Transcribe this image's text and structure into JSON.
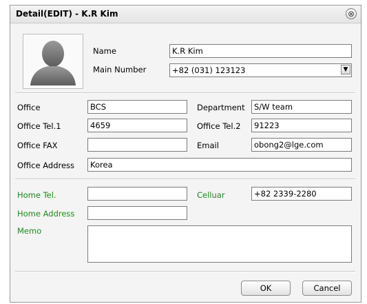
{
  "dialog": {
    "title": "Detail(EDIT) - K.R Kim",
    "close_glyph": "⊗"
  },
  "contact": {
    "name_label": "Name",
    "name_value": "K.R Kim",
    "main_number_label": "Main Number",
    "main_number_value": "+82 (031) 123123"
  },
  "office": {
    "office_label": "Office",
    "office_value": "BCS",
    "department_label": "Department",
    "department_value": "S/W team",
    "tel1_label": "Office Tel.1",
    "tel1_value": "4659",
    "tel2_label": "Office Tel.2",
    "tel2_value": "91223",
    "fax_label": "Office FAX",
    "fax_value": "",
    "email_label": "Email",
    "email_value": "obong2@lge.com",
    "address_label": "Office Address",
    "address_value": "Korea"
  },
  "home": {
    "tel_label": "Home Tel.",
    "tel_value": "",
    "cellular_label": "Celluar",
    "cellular_value": "+82 2339-2280",
    "address_label": "Home Address",
    "address_value": "",
    "memo_label": "Memo",
    "memo_value": ""
  },
  "buttons": {
    "ok": "OK",
    "cancel": "Cancel"
  },
  "colors": {
    "home_label": "#1c8a1c"
  },
  "icons": {
    "avatar": "person-silhouette-icon",
    "close": "close-circle-icon",
    "dropdown": "chevron-down-icon"
  }
}
